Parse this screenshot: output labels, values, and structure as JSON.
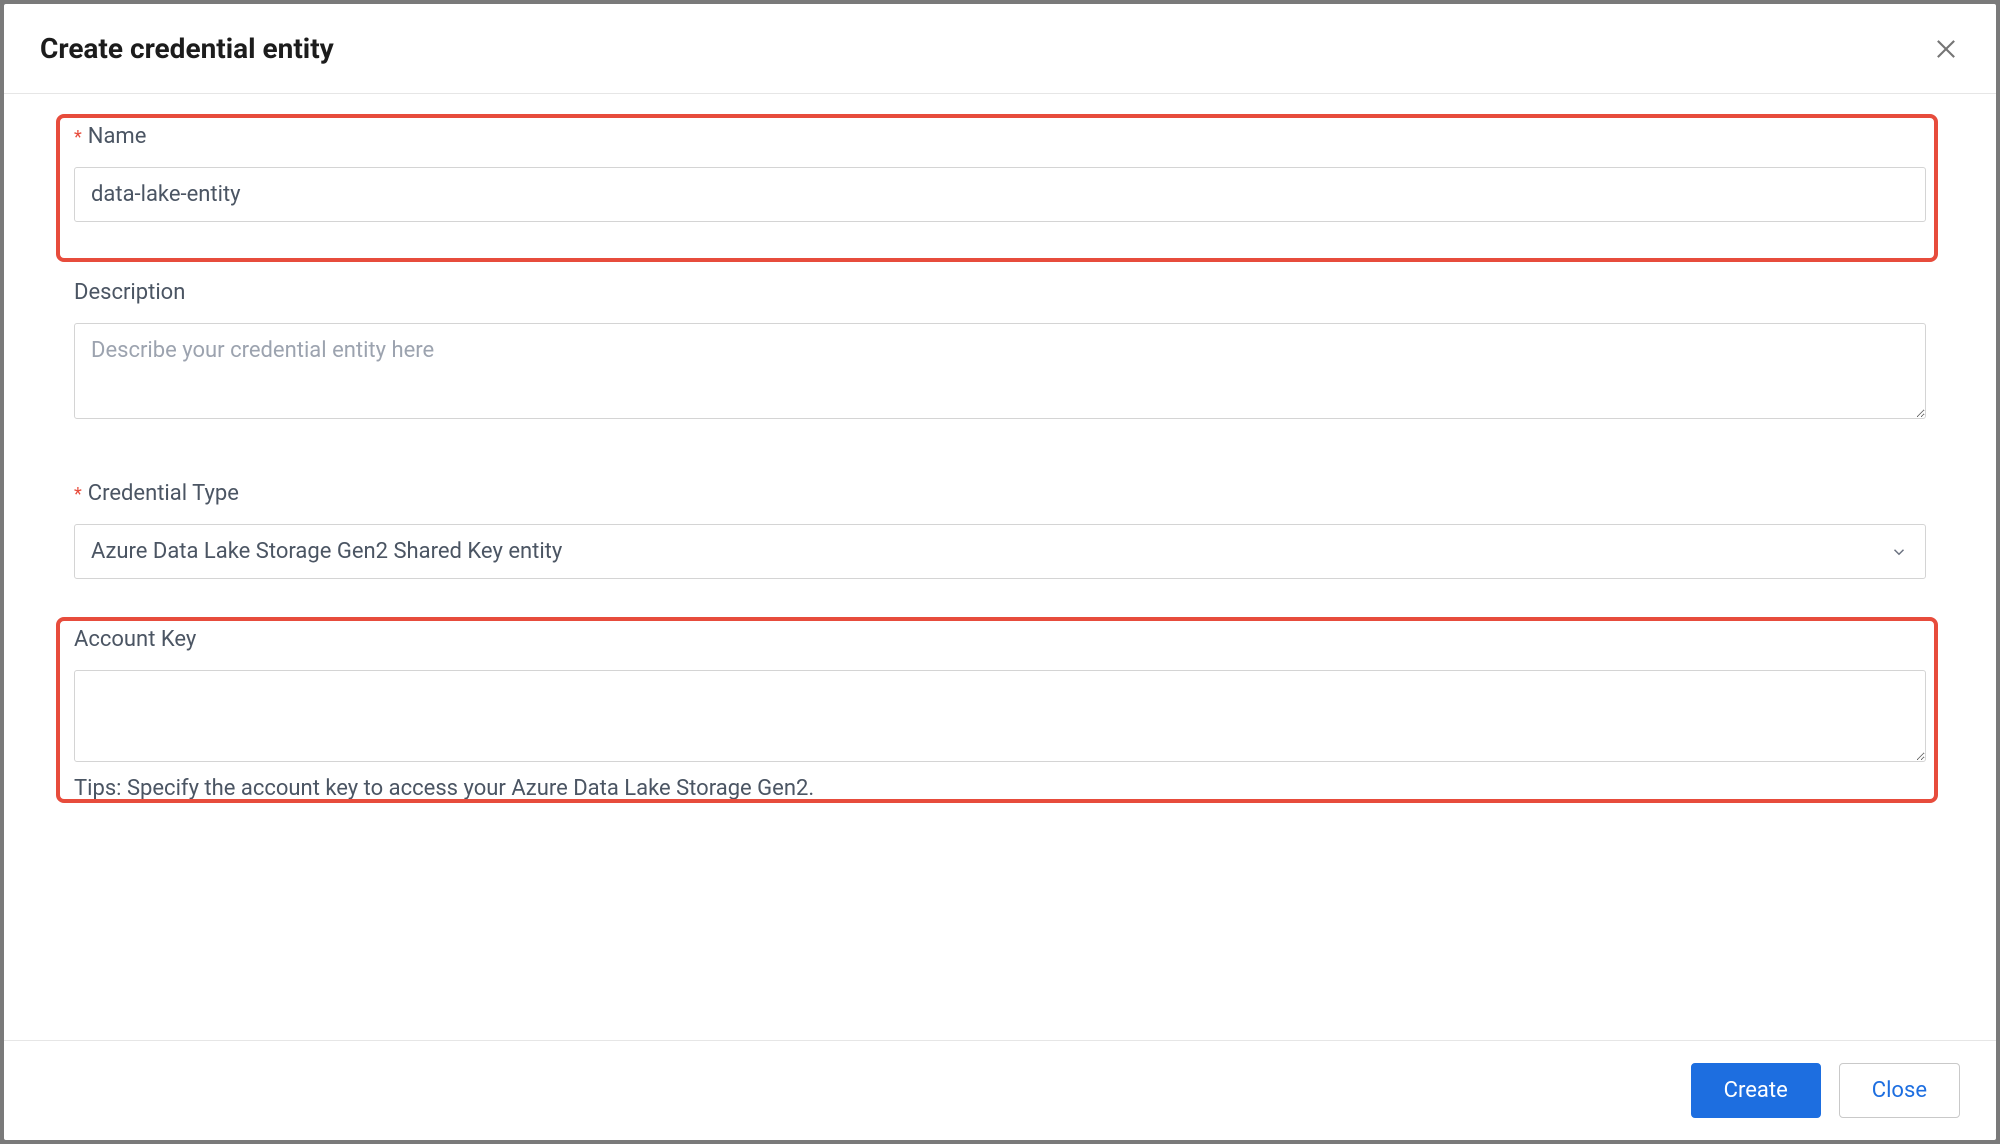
{
  "header": {
    "title": "Create credential entity"
  },
  "form": {
    "name": {
      "label": "Name",
      "value": "data-lake-entity",
      "required": true
    },
    "description": {
      "label": "Description",
      "placeholder": "Describe your credential entity here",
      "value": ""
    },
    "credential_type": {
      "label": "Credential Type",
      "selected": "Azure Data Lake Storage Gen2 Shared Key entity",
      "required": true
    },
    "account_key": {
      "label": "Account Key",
      "value": "",
      "tip": "Tips: Specify the account key to access your Azure Data Lake Storage Gen2."
    }
  },
  "footer": {
    "create_label": "Create",
    "close_label": "Close"
  }
}
